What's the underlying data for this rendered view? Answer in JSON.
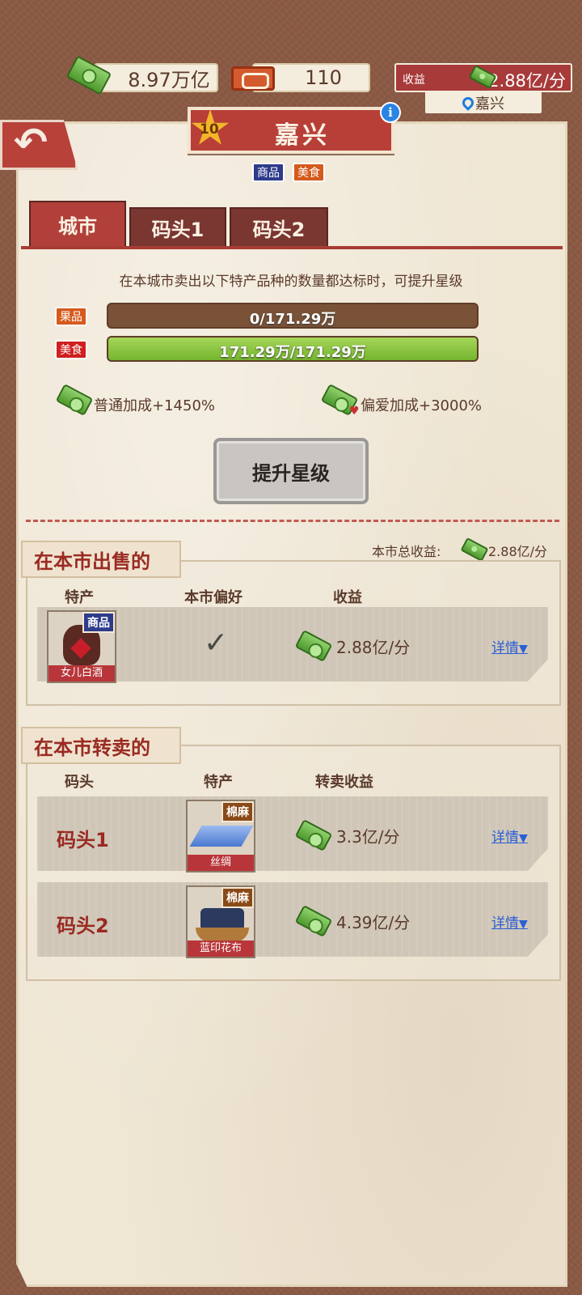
{
  "header": {
    "cash": "8.97万亿",
    "tickets": "110",
    "income_label": "收益",
    "income_value": "2.88亿/分",
    "location": "嘉兴"
  },
  "city": {
    "name": "嘉兴",
    "star_level": "10",
    "tags": [
      "商品",
      "美食"
    ]
  },
  "tabs": [
    {
      "label": "城市",
      "active": true
    },
    {
      "label": "码头1",
      "active": false
    },
    {
      "label": "码头2",
      "active": false
    }
  ],
  "upgrade": {
    "hint": "在本城市卖出以下特产品种的数量都达标时，可提升星级",
    "requirements": [
      {
        "tag": "果品",
        "tag_color": "#d55a1c",
        "text": "0/171.29万",
        "progress": 0
      },
      {
        "tag": "美食",
        "tag_color": "#d01f1f",
        "text": "171.29万/171.29万",
        "progress": 1
      }
    ],
    "normal_bonus": "普通加成+1450%",
    "favor_bonus": "偏爱加成+3000%",
    "button": "提升星级"
  },
  "sell_section": {
    "title": "在本市出售的",
    "total_label": "本市总收益:",
    "total_value": "2.88亿/分",
    "headers": [
      "特产",
      "本市偏好",
      "收益"
    ],
    "rows": [
      {
        "product": "女儿白酒",
        "tag": "商品",
        "preferred": true,
        "income": "2.88亿/分",
        "detail": "详情"
      }
    ]
  },
  "resell_section": {
    "title": "在本市转卖的",
    "headers": [
      "码头",
      "特产",
      "转卖收益"
    ],
    "rows": [
      {
        "dock": "码头1",
        "product": "丝绸",
        "tag": "棉麻",
        "income": "3.3亿/分",
        "detail": "详情"
      },
      {
        "dock": "码头2",
        "product": "蓝印花布",
        "tag": "棉麻",
        "income": "4.39亿/分",
        "detail": "详情"
      }
    ]
  }
}
